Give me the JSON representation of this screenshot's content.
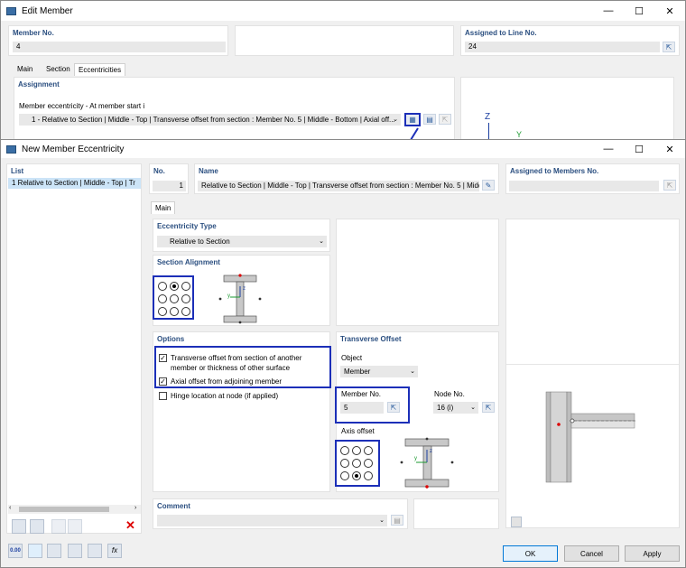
{
  "edit_member": {
    "title": "Edit Member",
    "member_no_label": "Member No.",
    "member_no": "4",
    "assigned_label": "Assigned to Line No.",
    "assigned_value": "24",
    "tabs": [
      "Main",
      "Section",
      "Eccentricities"
    ],
    "assignment_label": "Assignment",
    "ecc_start_label": "Member eccentricity - At member start i",
    "ecc_start_value": "1 - Relative to Section | Middle - Top | Transverse offset from section : Member No. 5 | Middle - Bottom | Axial off...",
    "axis_z": "Z",
    "axis_y": "Y"
  },
  "new_ecc": {
    "title": "New Member Eccentricity",
    "list_label": "List",
    "list_item": "1 Relative to Section | Middle - Top | Tr",
    "no_label": "No.",
    "no_value": "1",
    "name_label": "Name",
    "name_value": "Relative to Section | Middle - Top | Transverse offset from section : Member No. 5 | Middl",
    "assigned_label": "Assigned to Members No.",
    "tab_main": "Main",
    "ecc_type_label": "Eccentricity Type",
    "ecc_type_value": "Relative to Section",
    "section_alignment_label": "Section Alignment",
    "options_label": "Options",
    "opt1": "Transverse offset from section of another member or thickness of other surface",
    "opt2": "Axial offset from adjoining member",
    "opt3": "Hinge location at node (if applied)",
    "transverse_label": "Transverse Offset",
    "object_label": "Object",
    "object_value": "Member",
    "member_no_label": "Member No.",
    "member_no_value": "5",
    "node_no_label": "Node No.",
    "node_no_value": "16 (i)",
    "axis_offset_label": "Axis offset",
    "comment_label": "Comment",
    "ok": "OK",
    "cancel": "Cancel",
    "apply": "Apply",
    "units_icon_label": "0.00",
    "fx_icon_label": "fx",
    "axis_z": "z",
    "axis_y": "y"
  }
}
